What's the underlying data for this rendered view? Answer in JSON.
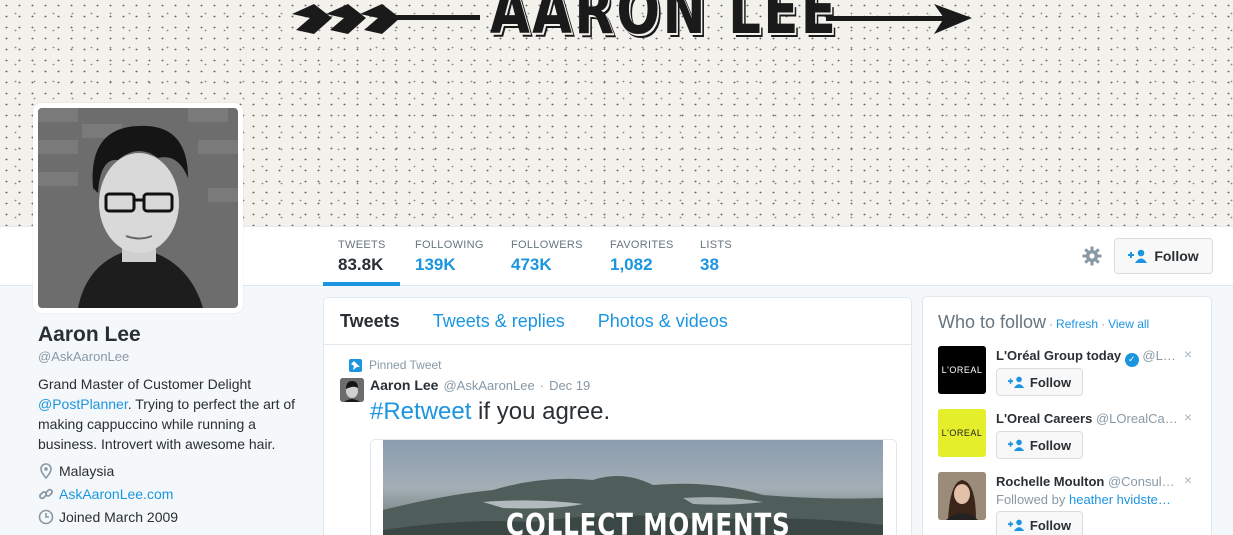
{
  "banner": {
    "title": "AARON LEE"
  },
  "stats": [
    {
      "label": "TWEETS",
      "value": "83.8K"
    },
    {
      "label": "FOLLOWING",
      "value": "139K"
    },
    {
      "label": "FOLLOWERS",
      "value": "473K"
    },
    {
      "label": "FAVORITES",
      "value": "1,082"
    },
    {
      "label": "LISTS",
      "value": "38"
    }
  ],
  "header": {
    "follow_label": "Follow"
  },
  "profile": {
    "name": "Aaron Lee",
    "handle": "@AskAaronLee",
    "bio_part1": "Grand Master of Customer Delight",
    "bio_mention": "@PostPlanner",
    "bio_part2": ". Trying to perfect the art of making cappuccino while running a business. Introvert with awesome hair.",
    "location": "Malaysia",
    "website": "AskAaronLee.com",
    "joined": "Joined March 2009"
  },
  "timeline": {
    "tabs": [
      "Tweets",
      "Tweets & replies",
      "Photos & videos"
    ],
    "pinned_label": "Pinned Tweet",
    "tweet": {
      "name": "Aaron Lee",
      "handle": "@AskAaronLee",
      "dot": "·",
      "date": "Dec 19",
      "hashtag": "#Retweet",
      "text": " if you agree.",
      "media_caption": "COLLECT MOMENTS"
    }
  },
  "who_to_follow": {
    "title": "Who to follow",
    "sep": "·",
    "refresh": "Refresh",
    "view_all": "View all",
    "close": "×",
    "follow_label": "Follow",
    "recs": [
      {
        "name": "L'Oréal Group today",
        "handle": "@L…",
        "logo": "L'OREAL",
        "sub": ""
      },
      {
        "name": "L'Oreal Careers",
        "handle": "@LOrealCa…",
        "logo": "L'OREAL",
        "sub": ""
      },
      {
        "name": "Rochelle Moulton",
        "handle": "@Consul…",
        "logo": "",
        "sub_prefix": "Followed by ",
        "sub_link": "heather hvidste…"
      }
    ]
  },
  "colors": {
    "accent": "#1b95e0",
    "loreal_yellow": "#e5ee2a"
  }
}
